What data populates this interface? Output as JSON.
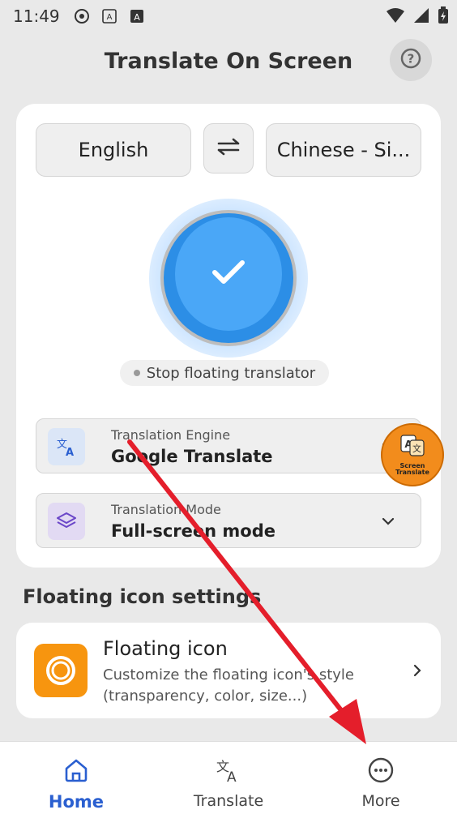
{
  "status_bar": {
    "time": "11:49"
  },
  "header": {
    "title": "Translate On Screen",
    "help_icon": "help-circle-icon"
  },
  "languages": {
    "source": "English",
    "target": "Chinese - Si..."
  },
  "translator": {
    "stop_label": "Stop floating translator",
    "active": true
  },
  "engine": {
    "label": "Translation Engine",
    "value": "Google Translate"
  },
  "mode": {
    "label": "Translation Mode",
    "value": "Full-screen mode"
  },
  "floating_bubble": {
    "text_line1": "Screen",
    "text_line2": "Translate"
  },
  "floating_section": {
    "title": "Floating icon settings",
    "item_title": "Floating icon",
    "item_desc": "Customize the floating icon's style (transparency, color, size...)"
  },
  "nav": {
    "items": [
      {
        "label": "Home",
        "icon": "home-icon",
        "active": true
      },
      {
        "label": "Translate",
        "icon": "translate-icon",
        "active": false
      },
      {
        "label": "More",
        "icon": "more-icon",
        "active": false
      }
    ]
  },
  "colors": {
    "accent": "#2a5fd0",
    "orb": "#4aa7f7",
    "orange": "#f7950f",
    "arrow": "#e41e2b"
  }
}
